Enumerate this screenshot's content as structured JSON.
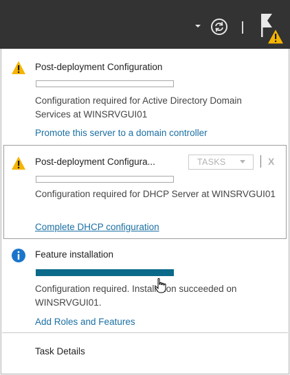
{
  "toolbar": {
    "dropdown_icon": "chevron-down-icon",
    "refresh_icon": "refresh-icon",
    "flag_icon": "notification-flag-icon",
    "warning_badge_icon": "warning-icon"
  },
  "notifications": {
    "item1": {
      "icon": "warning-icon",
      "title": "Post-deployment Configuration",
      "progress": 0,
      "description": "Configuration required for Active Directory Domain Services at WINSRVGUI01",
      "link": "Promote this server to a domain controller"
    },
    "item2": {
      "icon": "warning-icon",
      "title": "Post-deployment Configura...",
      "tasks_label": "TASKS",
      "close_label": "X",
      "progress": 0,
      "description": "Configuration required for DHCP Server at WINSRVGUI01",
      "link": "Complete DHCP configuration"
    },
    "item3": {
      "icon": "info-icon",
      "title": "Feature installation",
      "progress": 1,
      "description": "Configuration required. Installation succeeded on WINSRVGUI01.",
      "link": "Add Roles and Features"
    },
    "task_details": "Task Details"
  },
  "colors": {
    "topbar": "#333333",
    "link": "#1a6fa3",
    "progress_fill": "#0b6a8a",
    "warning": "#f5b400",
    "info": "#1a75c9"
  }
}
